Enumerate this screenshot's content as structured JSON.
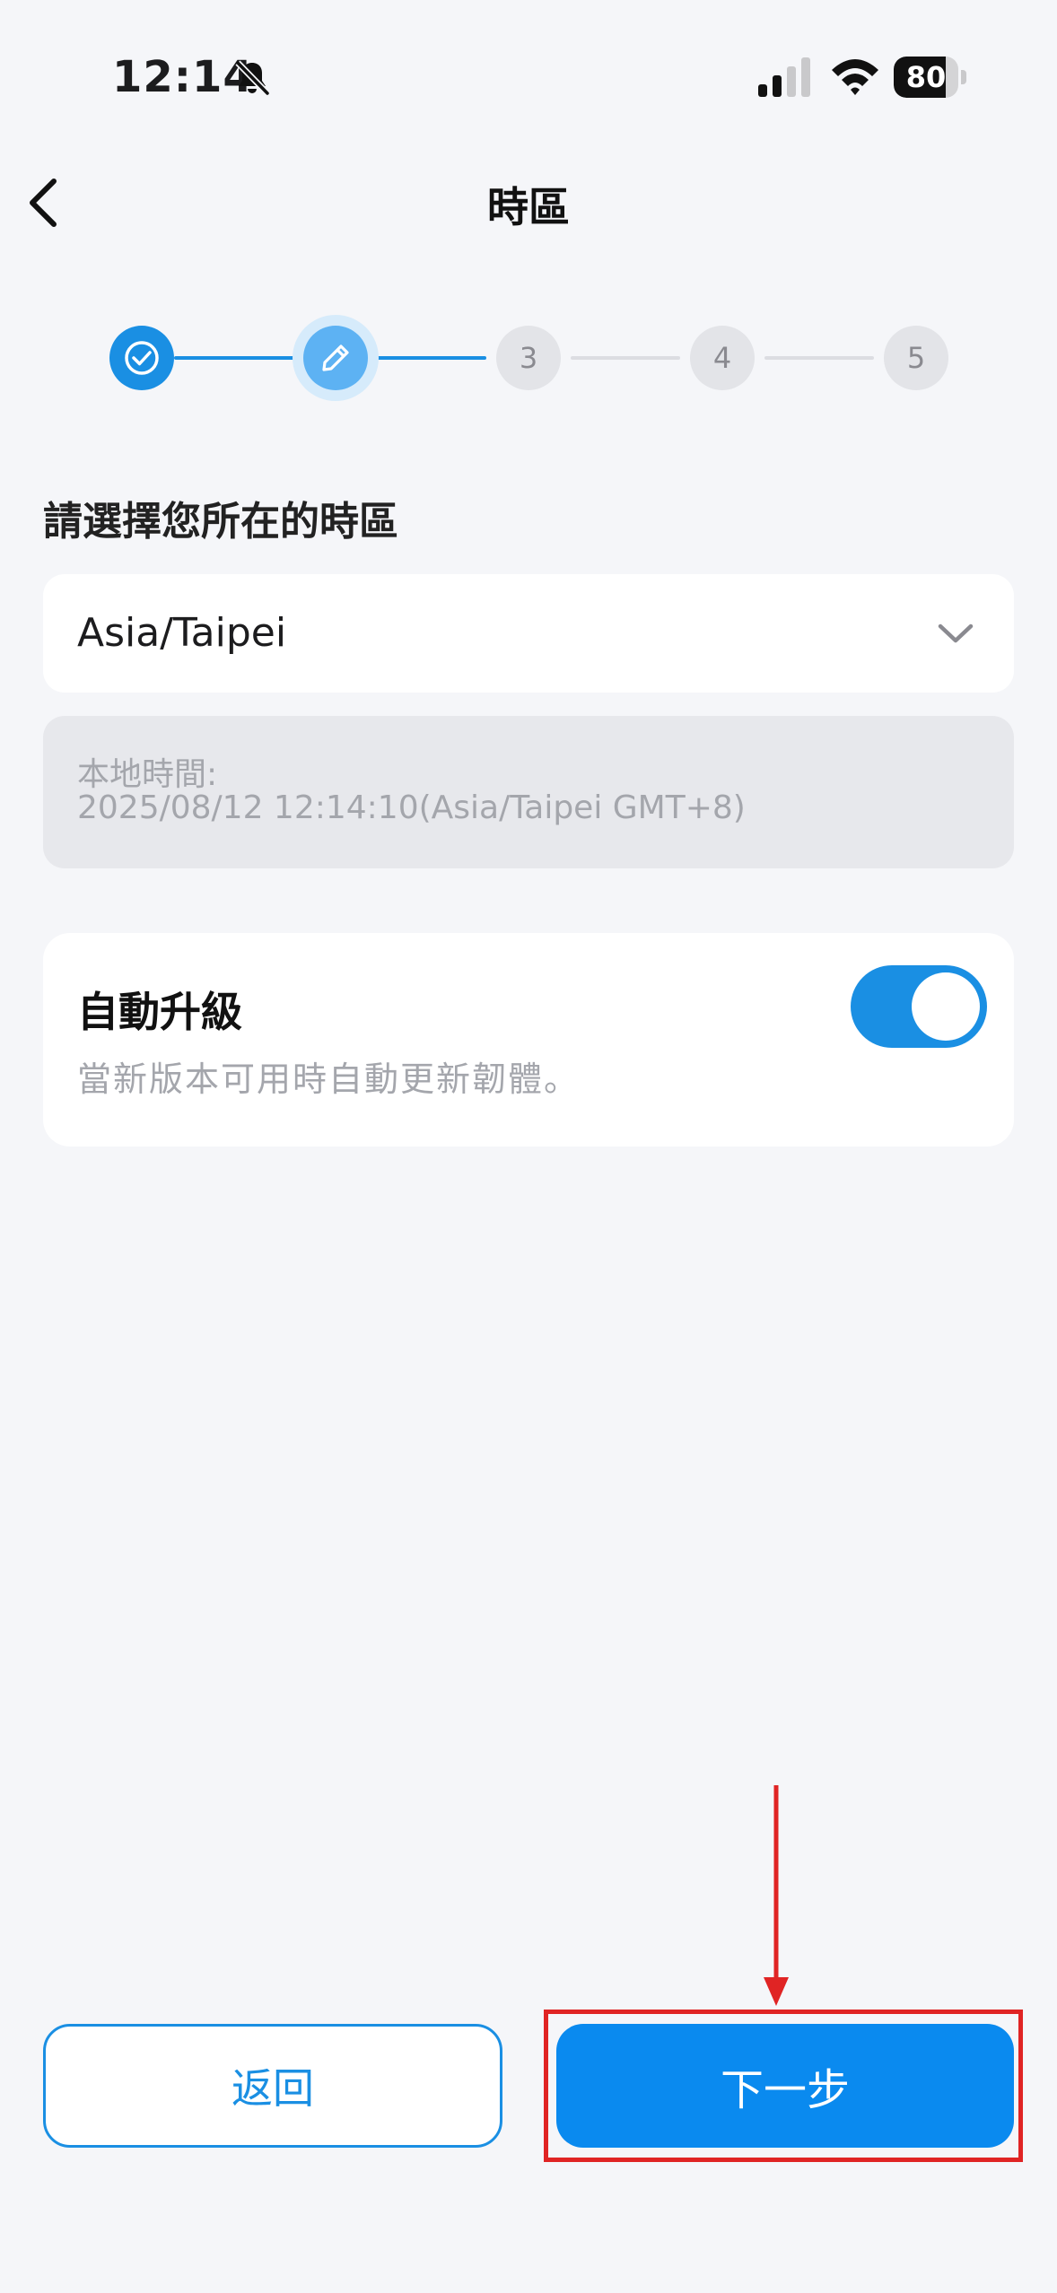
{
  "status_bar": {
    "time": "12:14",
    "battery": "80",
    "icons": [
      "bell-slash-icon",
      "cellular-signal-icon",
      "wifi-icon",
      "battery-icon"
    ]
  },
  "header": {
    "title": "時區",
    "back_icon": "chevron-left-icon"
  },
  "stepper": {
    "steps": [
      {
        "state": "done",
        "icon": "check-circle-icon"
      },
      {
        "state": "current",
        "icon": "pencil-icon"
      },
      {
        "state": "todo",
        "label": "3"
      },
      {
        "state": "todo",
        "label": "4"
      },
      {
        "state": "todo",
        "label": "5"
      }
    ],
    "active_color": "#1a8fe3"
  },
  "timezone": {
    "label": "請選擇您所在的時區",
    "selected": "Asia/Taipei",
    "local_time_label": "本地時間:",
    "local_time_value": "2025/08/12 12:14:10(Asia/Taipei GMT+8)"
  },
  "auto_upgrade": {
    "title": "自動升級",
    "description": "當新版本可用時自動更新韌體。",
    "enabled": true
  },
  "buttons": {
    "back_label": "返回",
    "next_label": "下一步"
  },
  "colors": {
    "accent": "#1a8fe3",
    "annotation": "#e02424"
  }
}
